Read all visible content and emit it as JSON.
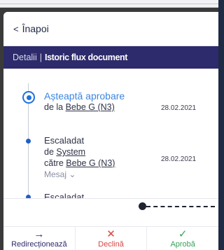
{
  "header": {
    "back_label": "Înapoi",
    "back_icon": "chevron-left-icon"
  },
  "tabs": {
    "details_label": "Detalii",
    "separator": "|",
    "history_label": "Istoric flux document"
  },
  "history": [
    {
      "title": "Așteaptă aprobare",
      "prefix": "de la",
      "user": "Bebe G (N3)",
      "date": "28.02.2021",
      "active": true
    },
    {
      "title": "Escaladat",
      "prefix": "de",
      "user": "System",
      "target_prefix": "către",
      "target": "Bebe G (N3)",
      "message_label": "Mesaj ⌄",
      "date": "28.02.2021",
      "active": false
    },
    {
      "title": "Escaladat",
      "active": false
    }
  ],
  "actions": {
    "redirect_label": "Redirecționează",
    "redirect_icon": "arrow-right-icon",
    "decline_label": "Declină",
    "decline_icon": "close-icon",
    "approve_label": "Aprobă",
    "approve_icon": "check-icon"
  },
  "colors": {
    "tab_bar": "#2d2b6b",
    "accent_blue": "#3d86e0",
    "decline": "#d64545",
    "approve": "#3aa05a"
  }
}
